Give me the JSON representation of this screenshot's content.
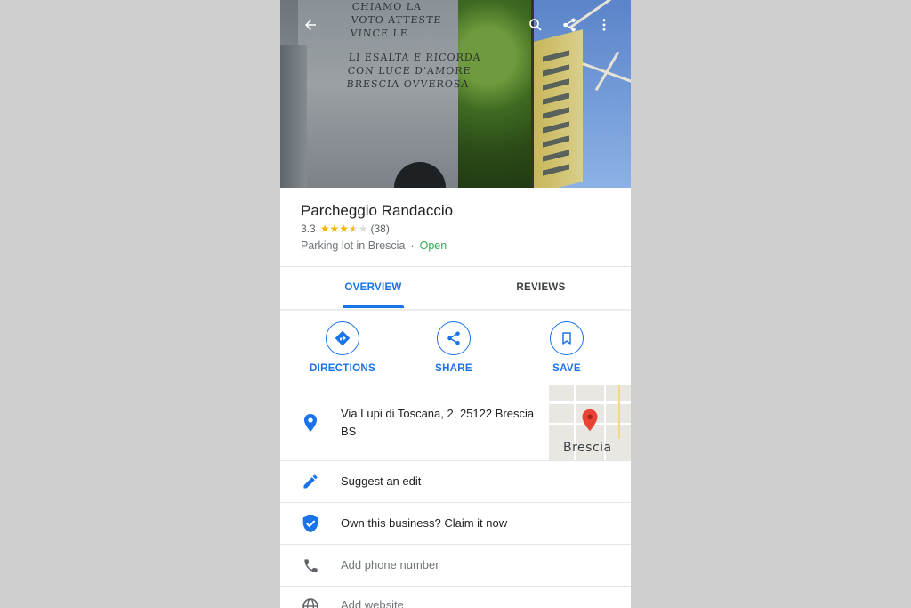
{
  "place": {
    "name": "Parcheggio Randaccio",
    "rating": "3.3",
    "rating_value": 3.3,
    "review_count": "(38)",
    "category": "Parking lot in Brescia",
    "separator": "·",
    "status": "Open"
  },
  "hero": {
    "engraving_lines": [
      "CHIAMO LA",
      "VOTO ATTESTE",
      "VINCE LE",
      "LI ESALTA E RICORDA",
      "CON LUCE D'AMORE",
      "BRESCIA OVVEROSA"
    ]
  },
  "tabs": [
    {
      "label": "OVERVIEW",
      "active": true
    },
    {
      "label": "REVIEWS",
      "active": false
    }
  ],
  "actions": [
    {
      "label": "DIRECTIONS",
      "icon": "directions-icon"
    },
    {
      "label": "SHARE",
      "icon": "share-icon"
    },
    {
      "label": "SAVE",
      "icon": "bookmark-icon"
    }
  ],
  "address": {
    "line1": "Via Lupi di Toscana, 2, 25122 Brescia",
    "line2": "BS",
    "map_label": "Brescia"
  },
  "rows": {
    "suggest_edit": "Suggest an edit",
    "claim": "Own this business? Claim it now",
    "phone": "Add phone number",
    "website": "Add website"
  },
  "colors": {
    "accent": "#1a73e8",
    "open": "#34a853",
    "star": "#f4b400",
    "pin": "#ea4335"
  }
}
